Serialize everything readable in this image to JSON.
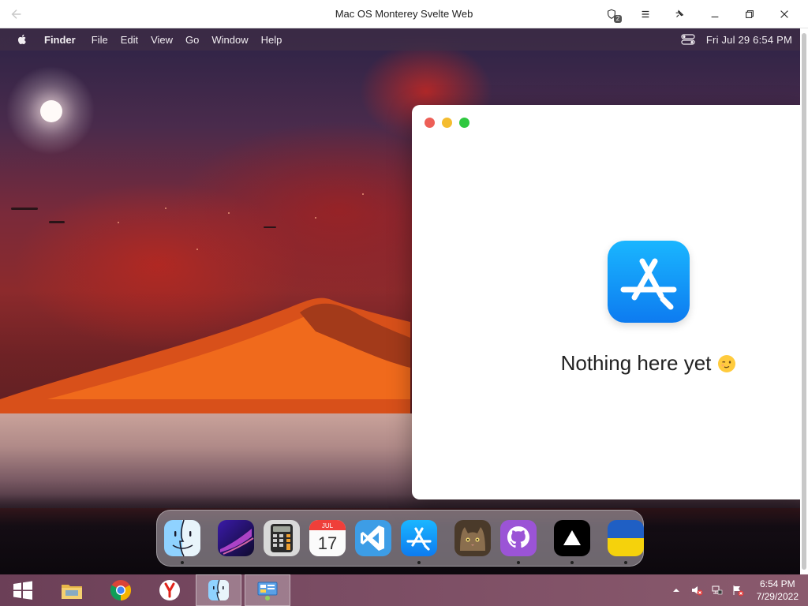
{
  "browser": {
    "title": "Mac OS Monterey Svelte Web",
    "extensions_badge": "2"
  },
  "menubar": {
    "app_name": "Finder",
    "menus": [
      "File",
      "Edit",
      "View",
      "Go",
      "Window",
      "Help"
    ],
    "datetime": "Fri Jul 29  6:54 PM"
  },
  "window": {
    "app_icon": "app-store-icon",
    "message": "Nothing here yet",
    "emoji": "wink-emoji"
  },
  "dock": {
    "items": [
      {
        "name": "Finder",
        "icon": "finder-icon",
        "running": true
      },
      {
        "name": "Launchpad",
        "icon": "launchpad-icon",
        "running": false
      },
      {
        "name": "Calculator",
        "icon": "calculator-icon",
        "running": false
      },
      {
        "name": "Calendar",
        "icon": "calendar-icon",
        "running": false,
        "month": "JUL",
        "day": "17"
      },
      {
        "name": "VS Code",
        "icon": "vscode-icon",
        "running": false
      },
      {
        "name": "App Store",
        "icon": "app-store-icon",
        "running": true
      },
      {
        "name": "Purus Twitter",
        "icon": "cat-icon",
        "running": false
      },
      {
        "name": "GitHub",
        "icon": "github-icon",
        "running": true
      },
      {
        "name": "Vercel",
        "icon": "vercel-icon",
        "running": true
      },
      {
        "name": "Ukraine",
        "icon": "ukraine-flag-icon",
        "running": true
      }
    ]
  },
  "taskbar": {
    "time": "6:54 PM",
    "date": "7/29/2022"
  },
  "colors": {
    "close": "#ed5f57",
    "minimize": "#f4bc2f",
    "maximize": "#2fc840",
    "app_store_blue": "#0d7bf0",
    "taskbar": "#7a4c63"
  }
}
